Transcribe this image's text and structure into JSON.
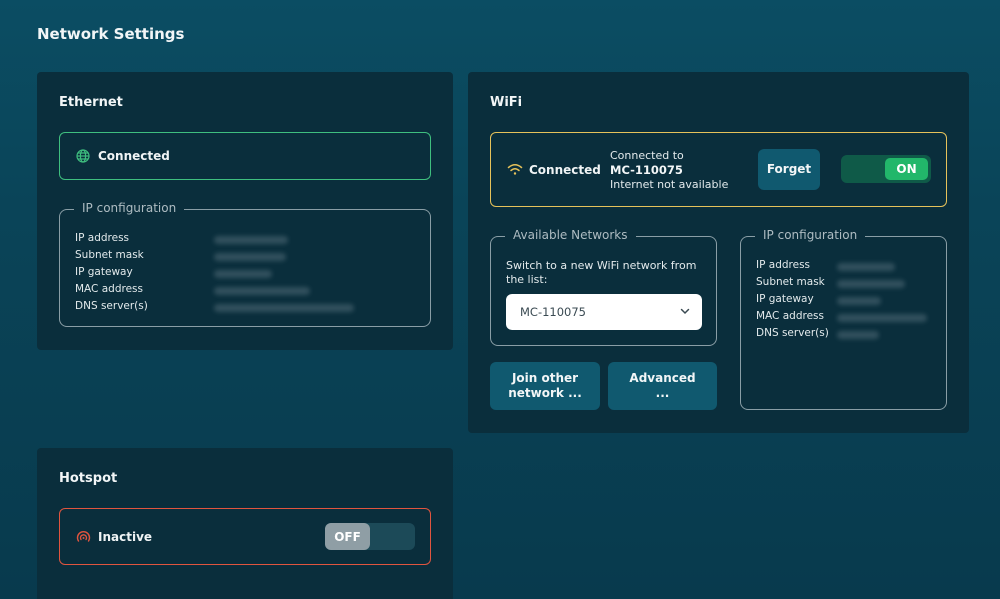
{
  "page": {
    "title": "Network Settings"
  },
  "ethernet": {
    "title": "Ethernet",
    "status": "Connected",
    "status_color": "#3fbf7f",
    "ip_config": {
      "legend": "IP configuration",
      "rows": [
        {
          "label": "IP address"
        },
        {
          "label": "Subnet mask"
        },
        {
          "label": "IP gateway"
        },
        {
          "label": "MAC address"
        },
        {
          "label": "DNS server(s)"
        }
      ]
    }
  },
  "wifi": {
    "title": "WiFi",
    "status": "Connected",
    "status_color": "#e6c25a",
    "connected_to_label": "Connected to",
    "network_name": "MC-110075",
    "internet_status": "Internet not available",
    "forget_label": "Forget",
    "toggle_label": "ON",
    "toggle_color": "#22b76a",
    "available": {
      "legend": "Available Networks",
      "instruction": "Switch to a new WiFi network from the list:",
      "selected": "MC-110075"
    },
    "join_other_label": "Join other network ...",
    "advanced_label": "Advanced ...",
    "ip_config": {
      "legend": "IP configuration",
      "rows": [
        {
          "label": "IP address"
        },
        {
          "label": "Subnet mask"
        },
        {
          "label": "IP gateway"
        },
        {
          "label": "MAC address"
        },
        {
          "label": "DNS server(s)"
        }
      ]
    }
  },
  "hotspot": {
    "title": "Hotspot",
    "status": "Inactive",
    "status_color": "#e0553f",
    "toggle_label": "OFF"
  }
}
